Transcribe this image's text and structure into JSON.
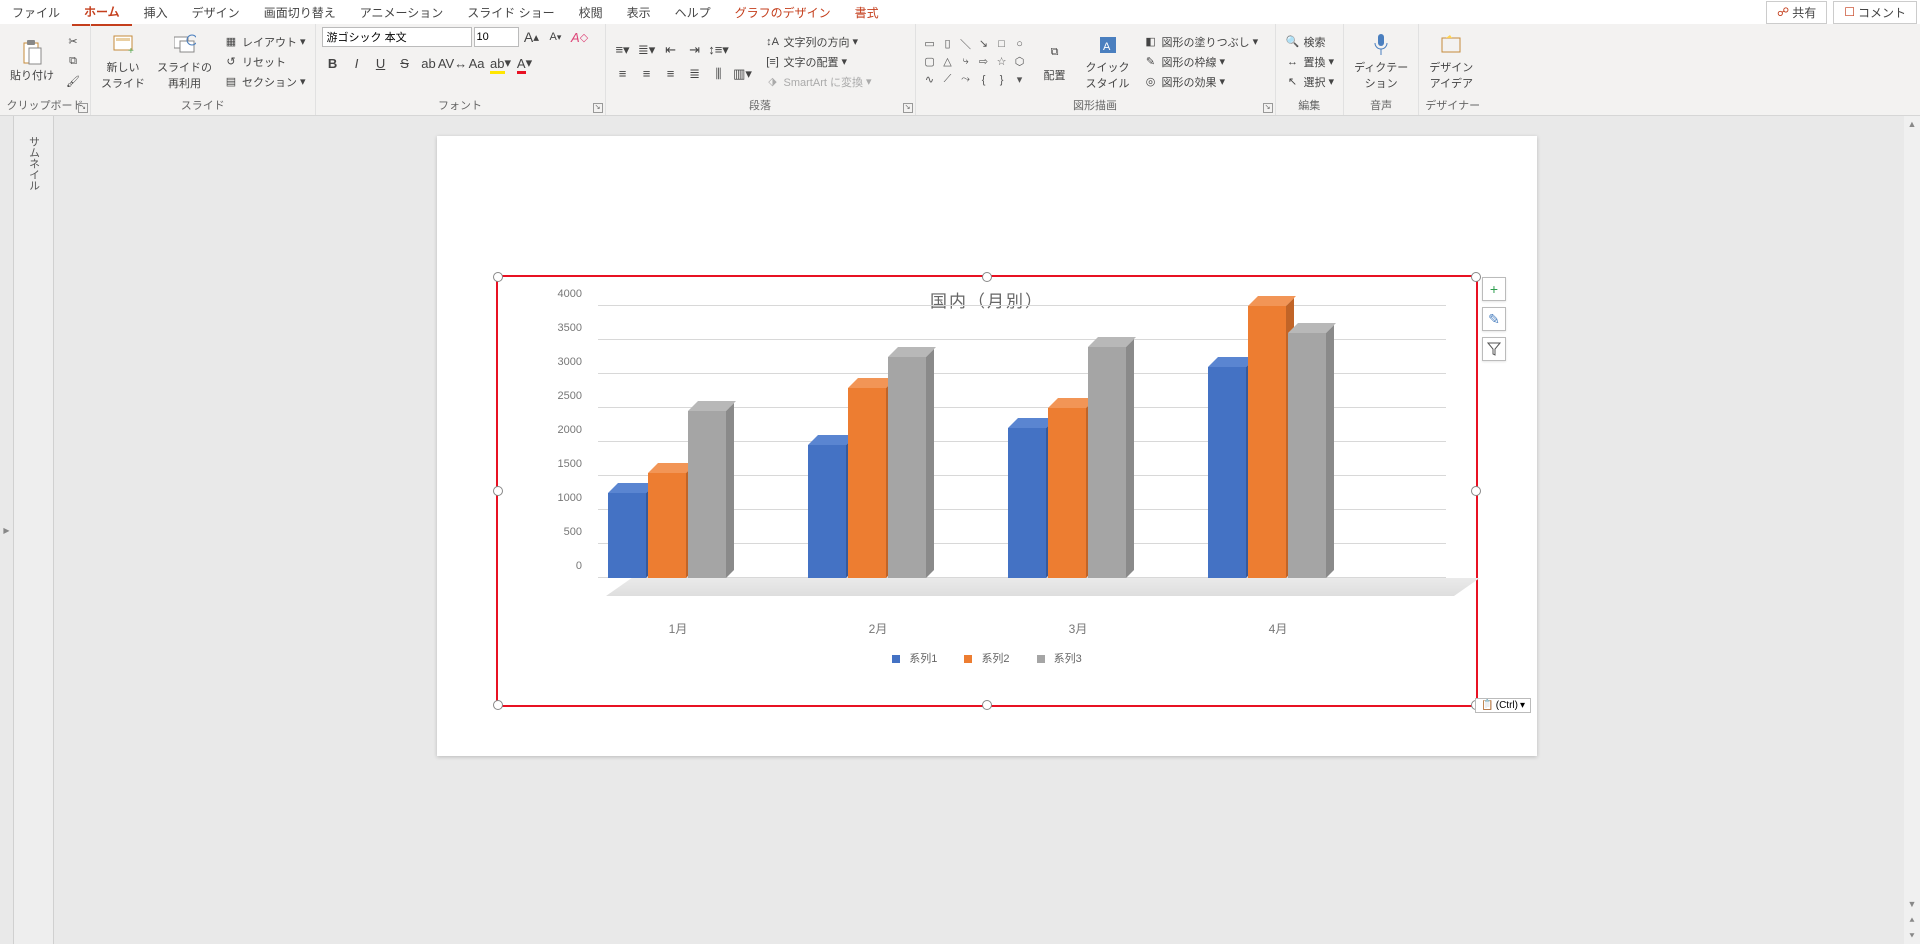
{
  "menu": {
    "tabs": [
      "ファイル",
      "ホーム",
      "挿入",
      "デザイン",
      "画面切り替え",
      "アニメーション",
      "スライド ショー",
      "校閲",
      "表示",
      "ヘルプ",
      "グラフのデザイン",
      "書式"
    ],
    "active_index": 1,
    "contextual_indices": [
      10,
      11
    ],
    "share": "共有",
    "comment": "コメント"
  },
  "ribbon": {
    "clipboard": {
      "paste": "貼り付け",
      "label": "クリップボード"
    },
    "slides": {
      "new_slide": "新しい\nスライド",
      "reuse": "スライドの\n再利用",
      "layout": "レイアウト",
      "reset": "リセット",
      "section": "セクション",
      "label": "スライド"
    },
    "font": {
      "family": "游ゴシック 本文",
      "size": "10",
      "increase": "A",
      "decrease": "A",
      "clear": "A",
      "bold": "B",
      "italic": "I",
      "underline": "U",
      "strike": "S",
      "shadow": "ab",
      "spacing": "AV",
      "case": "Aa",
      "label": "フォント"
    },
    "paragraph": {
      "direction": "文字列の方向",
      "align_text": "文字の配置",
      "smartart": "SmartArt に変換",
      "label": "段落"
    },
    "drawing": {
      "arrange": "配置",
      "quick_styles": "クイック\nスタイル",
      "fill": "図形の塗りつぶし",
      "outline": "図形の枠線",
      "effects": "図形の効果",
      "label": "図形描画"
    },
    "editing": {
      "find": "検索",
      "replace": "置換",
      "select": "選択",
      "label": "編集"
    },
    "voice": {
      "dictate": "ディクテー\nション",
      "label": "音声"
    },
    "designer": {
      "ideas": "デザイン\nアイデア",
      "label": "デザイナー"
    }
  },
  "thumb_label": "サムネイル",
  "chart_side": {
    "plus": "+",
    "brush": "✎",
    "filter": "⧩"
  },
  "paste_options": "(Ctrl)",
  "chart_data": {
    "type": "bar",
    "title": "国内（月別）",
    "categories": [
      "1月",
      "2月",
      "3月",
      "4月"
    ],
    "series": [
      {
        "name": "系列1",
        "values": [
          1250,
          1950,
          2200,
          3100
        ],
        "color": "#4472c4"
      },
      {
        "name": "系列2",
        "values": [
          1550,
          2800,
          2500,
          4000
        ],
        "color": "#ed7d31"
      },
      {
        "name": "系列3",
        "values": [
          2450,
          3250,
          3400,
          3600
        ],
        "color": "#a5a5a5"
      }
    ],
    "ylim": [
      0,
      4000
    ],
    "yticks": [
      0,
      500,
      1000,
      1500,
      2000,
      2500,
      3000,
      3500,
      4000
    ]
  }
}
